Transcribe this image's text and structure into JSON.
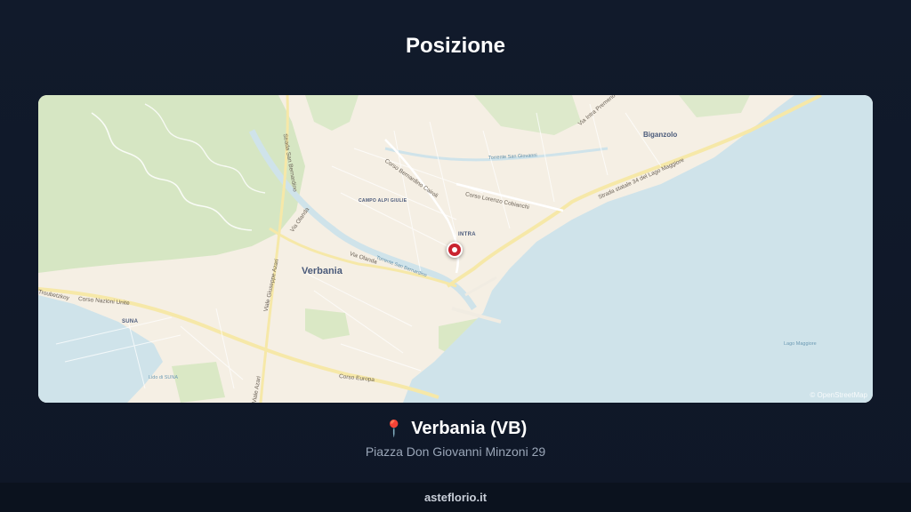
{
  "header": {
    "title": "Posizione"
  },
  "map": {
    "place_labels": {
      "verbania": "Verbania",
      "intra": "INTRA",
      "suna": "SUNA",
      "biganzolo": "Biganzolo",
      "campagna": "CAMPO ALPI GIULIE"
    },
    "street_labels": {
      "corso_cairoli": "Corso Bernardino Cairoli",
      "corso_cobianchi": "Corso Lorenzo Cobianchi",
      "via_olanda_1": "Via Olanda",
      "via_olanda_2": "Via Olanda",
      "viale_azari": "Viale Giuseppe Azari",
      "viale_azari_2": "Viale Azari",
      "corso_nazioni_unite": "Corso Nazioni Unite",
      "corso_europa": "Corso Europa",
      "strada_statale": "Strada statale 34 del Lago Maggiore",
      "via_intra_premeno": "Via Intra Premeno",
      "troubetzkoy": "Troubetzkoy",
      "strada_san_bernardino": "Strada San Bernardino"
    },
    "water_labels": {
      "lago_maggiore": "Lago Maggiore",
      "lido_suna": "Lido di SUNA",
      "torrente_san_bernardino": "Torrente San Bernardino",
      "torrente_san_giovanni": "Torrente San Giovanni"
    },
    "attribution": "© OpenStreetMap",
    "colors": {
      "land": "#f5efe4",
      "water": "#cfe3ea",
      "forest": "#d8e8c6",
      "park": "#dcebc8",
      "major_road": "#f6e8a8",
      "marker": "#c9232f"
    }
  },
  "location": {
    "city": "Verbania (VB)",
    "address": "Piazza Don Giovanni Minzoni 29"
  },
  "footer": {
    "brand": "asteflorio.it"
  }
}
